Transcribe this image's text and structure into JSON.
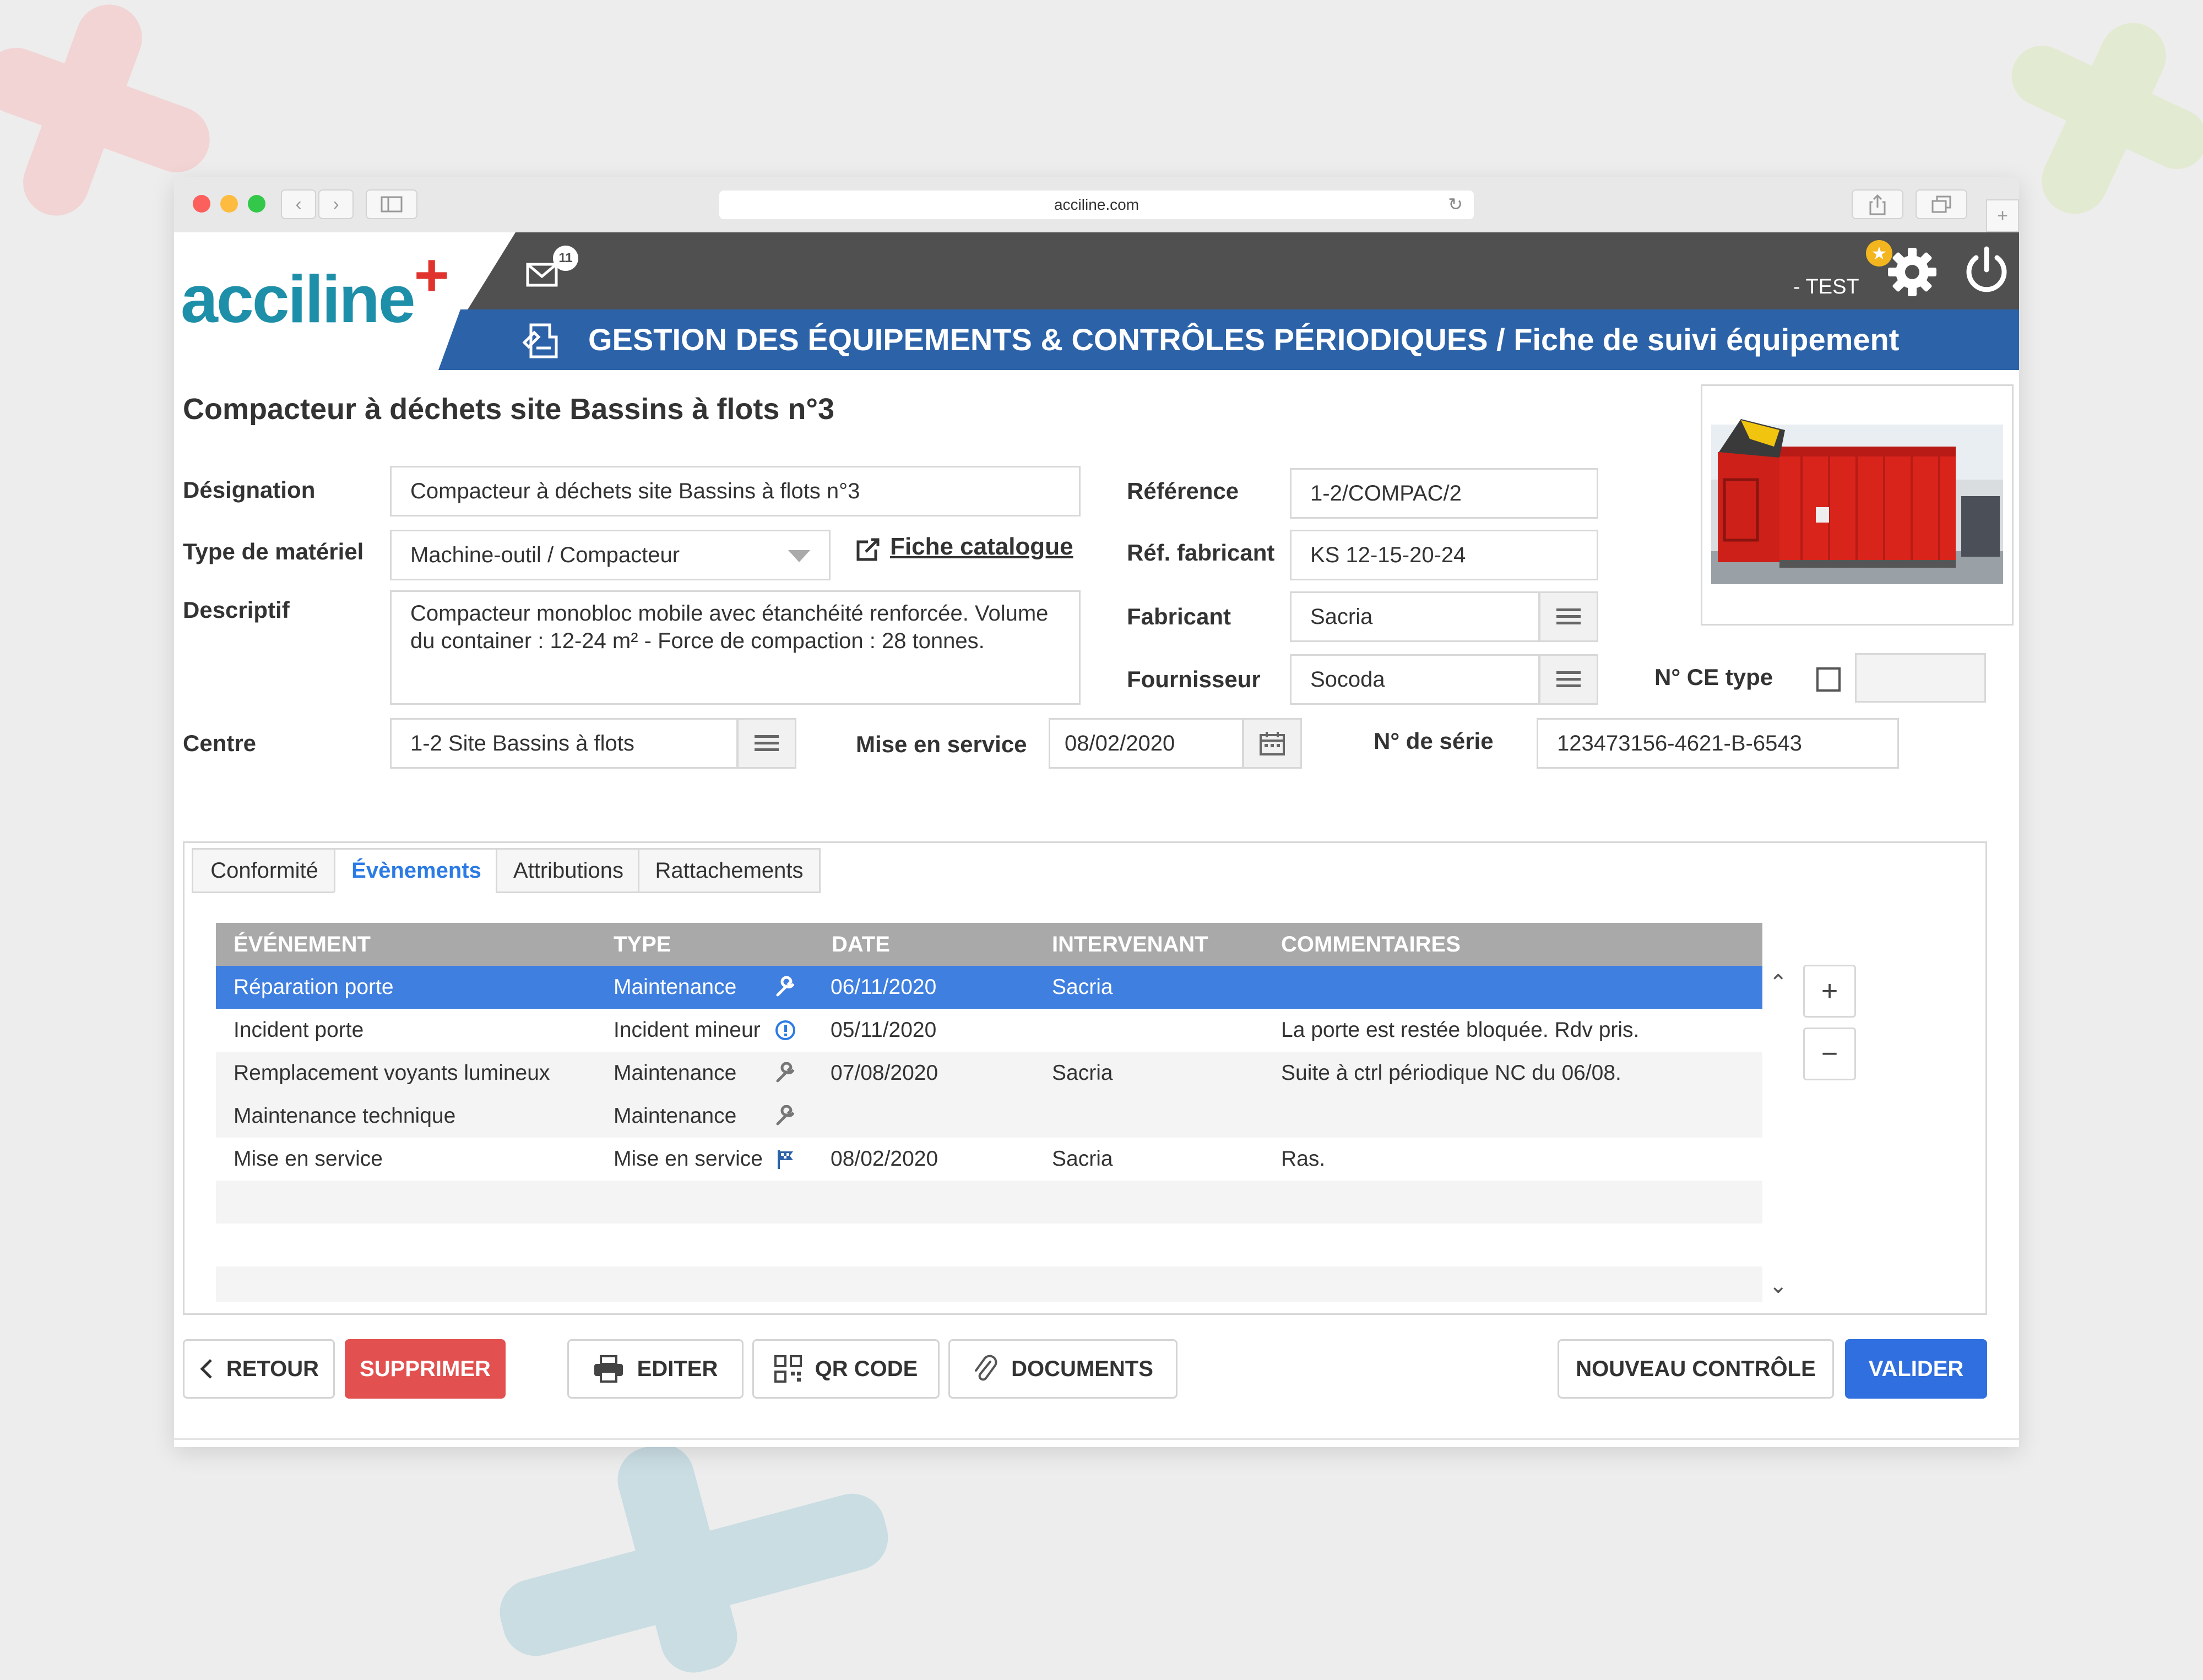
{
  "browser": {
    "url": "acciline.com"
  },
  "app": {
    "logo_text": "acciline",
    "logo_plus": "+",
    "mail_count": "11",
    "user_label": "- TEST",
    "header_title": "GESTION DES ÉQUIPEMENTS & CONTRÔLES PÉRIODIQUES /  Fiche de suivi équipement"
  },
  "form": {
    "page_title": "Compacteur à déchets site Bassins à flots n°3",
    "designation": {
      "label": "Désignation",
      "value": "Compacteur à déchets site Bassins à flots n°3"
    },
    "type_materiel": {
      "label": "Type de matériel",
      "value": "Machine-outil / Compacteur"
    },
    "fiche_catalogue": "Fiche catalogue",
    "descriptif": {
      "label": "Descriptif",
      "value": "Compacteur monobloc mobile avec étanchéité renforcée. Volume du container : 12-24 m² - Force de compaction : 28 tonnes."
    },
    "centre": {
      "label": "Centre",
      "value": "1-2 Site Bassins à flots"
    },
    "mise_en_service": {
      "label": "Mise en service",
      "value": "08/02/2020"
    },
    "reference": {
      "label": "Référence",
      "value": "1-2/COMPAC/2"
    },
    "ref_fabricant": {
      "label": "Réf. fabricant",
      "value": "KS 12-15-20-24"
    },
    "fabricant": {
      "label": "Fabricant",
      "value": "Sacria"
    },
    "fournisseur": {
      "label": "Fournisseur",
      "value": "Socoda"
    },
    "ce_type": {
      "label": "N° CE type",
      "checked": false,
      "value": ""
    },
    "num_serie": {
      "label": "N° de série",
      "value": "123473156-4621-B-6543"
    }
  },
  "tabs": [
    {
      "label": "Conformité",
      "active": false
    },
    {
      "label": "Évènements",
      "active": true
    },
    {
      "label": "Attributions",
      "active": false
    },
    {
      "label": "Rattachements",
      "active": false
    }
  ],
  "events_table": {
    "columns": [
      "ÉVÉNEMENT",
      "TYPE",
      "DATE",
      "INTERVENANT",
      "COMMENTAIRES"
    ],
    "rows": [
      {
        "evenement": "Réparation porte",
        "type": "Maintenance",
        "icon": "wrench-icon",
        "date": "06/11/2020",
        "intervenant": "Sacria",
        "commentaires": ""
      },
      {
        "evenement": "Incident porte",
        "type": "Incident mineur",
        "icon": "info-icon",
        "date": "05/11/2020",
        "intervenant": "",
        "commentaires": "La porte est restée bloquée. Rdv pris."
      },
      {
        "evenement": "Remplacement voyants lumineux",
        "type": "Maintenance",
        "icon": "wrench-icon",
        "date": "07/08/2020",
        "intervenant": "Sacria",
        "commentaires": "Suite à ctrl périodique NC du 06/08."
      },
      {
        "evenement": "Maintenance technique",
        "type": "Maintenance",
        "icon": "wrench-icon",
        "date": "",
        "intervenant": "",
        "commentaires": ""
      },
      {
        "evenement": "Mise en service",
        "type": "Mise en service",
        "icon": "flag-icon",
        "date": "08/02/2020",
        "intervenant": "Sacria",
        "commentaires": "Ras."
      }
    ],
    "add_label": "+",
    "remove_label": "−"
  },
  "actions": {
    "retour": "RETOUR",
    "supprimer": "SUPPRIMER",
    "editer": "EDITER",
    "qr_code": "QR CODE",
    "documents": "DOCUMENTS",
    "nouveau_controle": "NOUVEAU CONTRÔLE",
    "valider": "VALIDER"
  },
  "colors": {
    "header_blue": "#2c62a8",
    "selected_row": "#3f7fe0",
    "danger": "#e35050",
    "primary": "#2f6fdf",
    "logo_teal": "#1e8fa8",
    "logo_red": "#e0332d"
  }
}
